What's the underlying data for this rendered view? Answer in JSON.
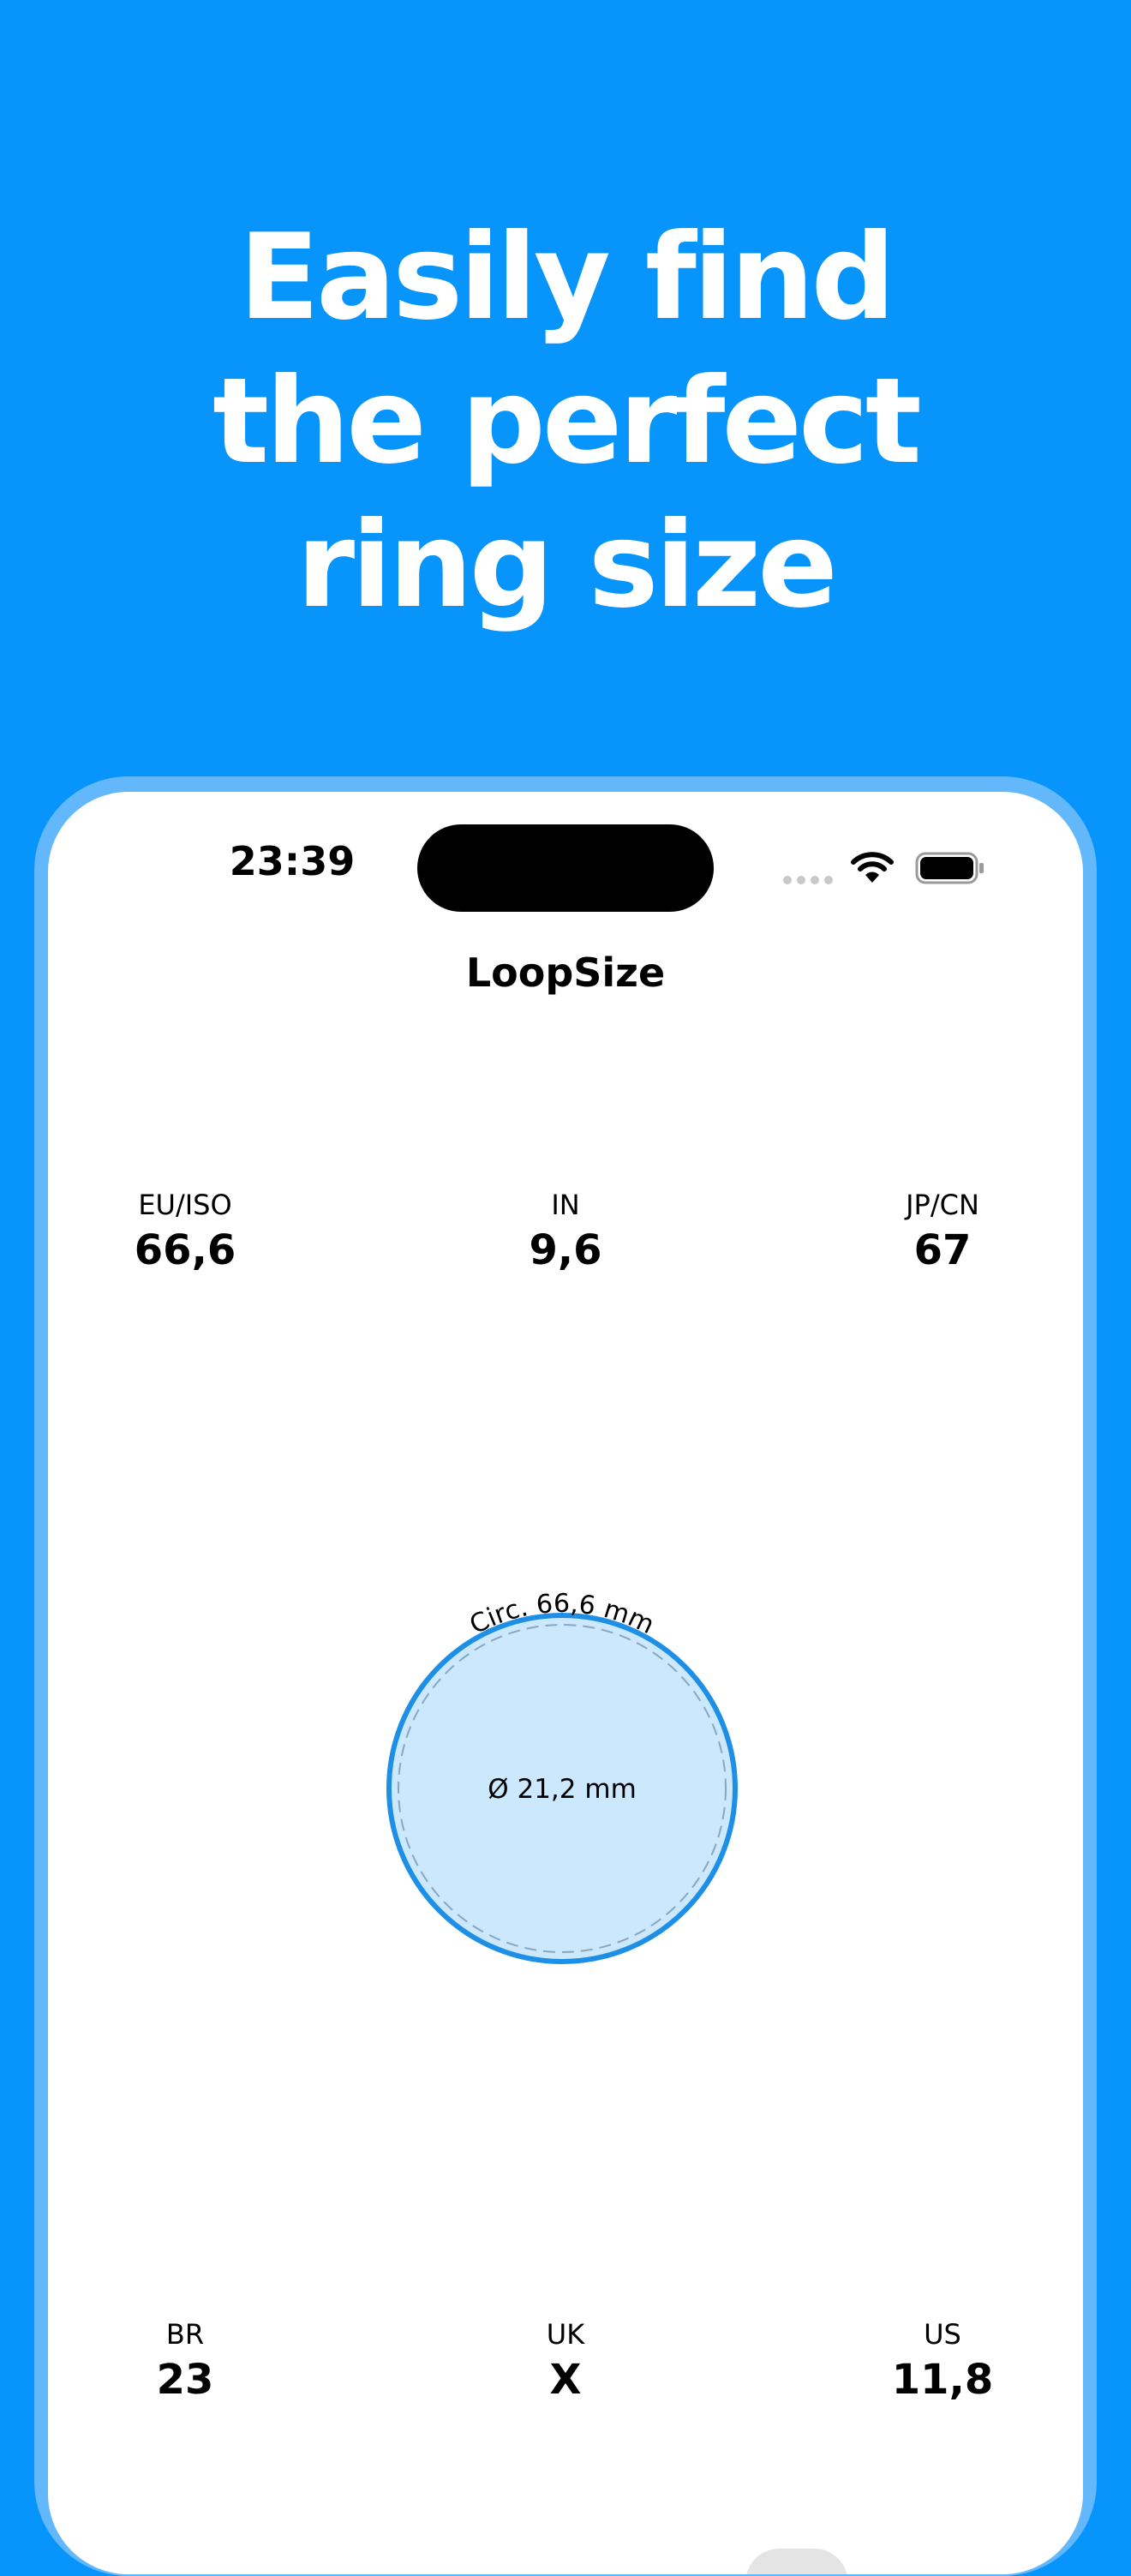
{
  "headline": {
    "line1": "Easily find",
    "line2": "the perfect",
    "line3": "ring size"
  },
  "status_bar": {
    "time": "23:39",
    "wifi_icon": "wifi-icon",
    "battery_icon": "battery-icon"
  },
  "app": {
    "title": "LoopSize"
  },
  "sizes_top": [
    {
      "label": "EU/ISO",
      "value": "66,6"
    },
    {
      "label": "IN",
      "value": "9,6"
    },
    {
      "label": "JP/CN",
      "value": "67"
    }
  ],
  "ring": {
    "circumference_label": "Circ. 66,6 mm",
    "diameter_label": "Ø 21,2 mm"
  },
  "sizes_bottom": [
    {
      "label": "BR",
      "value": "23"
    },
    {
      "label": "UK",
      "value": "X"
    },
    {
      "label": "US",
      "value": "11,8"
    }
  ],
  "colors": {
    "background": "#0795fb",
    "frame": "#62b8fb",
    "ring_stroke": "#1e8fe6",
    "ring_fill": "#cce8fd"
  }
}
